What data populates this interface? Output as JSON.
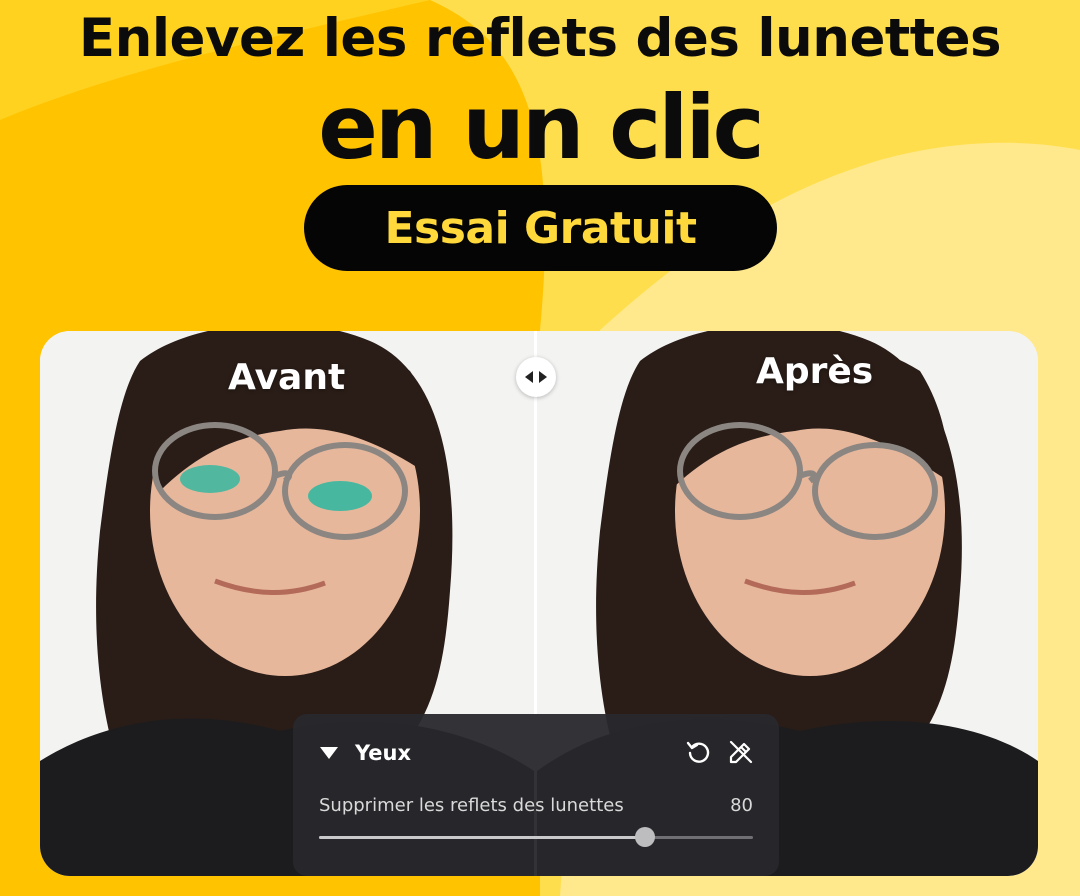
{
  "headline": {
    "line1": "Enlevez les reflets des lunettes",
    "line2": "en un clic"
  },
  "cta": {
    "label": "Essai Gratuit"
  },
  "comparison": {
    "before_label": "Avant",
    "after_label": "Après",
    "handle_icon": "left-right-arrows-icon"
  },
  "panel": {
    "section_title": "Yeux",
    "collapse_icon": "triangle-down-icon",
    "reset_icon": "reset-icon",
    "edit_icon": "eraser-edit-icon",
    "slider": {
      "label": "Supprimer les reflets des lunettes",
      "value": "80",
      "fraction": 0.75
    }
  },
  "colors": {
    "background": "#FFC300",
    "background_light": "#FFE066",
    "cta_background": "#050505",
    "cta_text": "#FFD93B",
    "panel": "#28282C",
    "lens_reflection": "#1FB8A0"
  }
}
